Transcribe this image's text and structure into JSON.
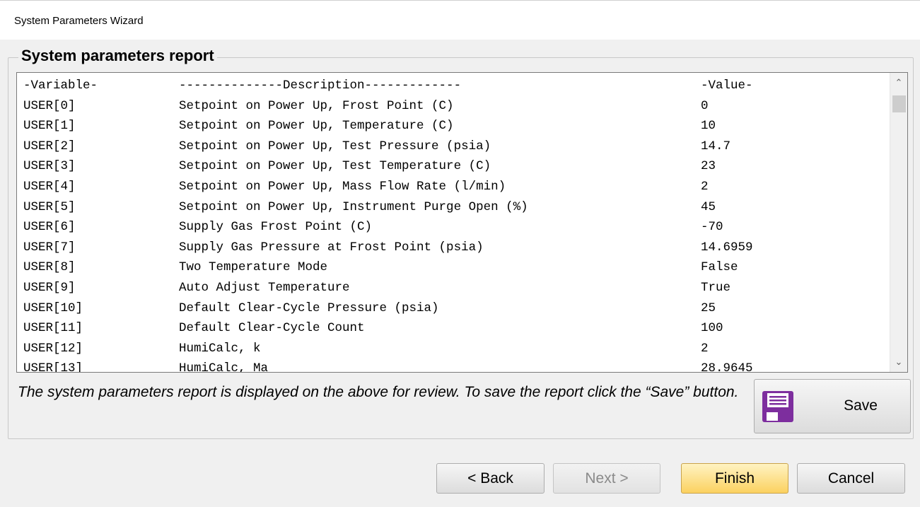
{
  "window": {
    "title": "System Parameters Wizard"
  },
  "group": {
    "legend": "System parameters report"
  },
  "report": {
    "header": {
      "variable": "-Variable-",
      "description": "--------------Description-------------",
      "value": "-Value-"
    },
    "rows": [
      {
        "variable": "USER[0]",
        "description": "Setpoint on Power Up, Frost Point (C)",
        "value": "0"
      },
      {
        "variable": "USER[1]",
        "description": "Setpoint on Power Up, Temperature (C)",
        "value": "10"
      },
      {
        "variable": "USER[2]",
        "description": "Setpoint on Power Up, Test Pressure (psia)",
        "value": "14.7"
      },
      {
        "variable": "USER[3]",
        "description": "Setpoint on Power Up, Test Temperature (C)",
        "value": "23"
      },
      {
        "variable": "USER[4]",
        "description": "Setpoint on Power Up, Mass Flow Rate (l/min)",
        "value": "2"
      },
      {
        "variable": "USER[5]",
        "description": "Setpoint on Power Up, Instrument Purge Open (%)",
        "value": "45"
      },
      {
        "variable": "USER[6]",
        "description": "Supply Gas Frost Point (C)",
        "value": "-70"
      },
      {
        "variable": "USER[7]",
        "description": "Supply Gas Pressure at Frost Point (psia)",
        "value": "14.6959"
      },
      {
        "variable": "USER[8]",
        "description": "Two Temperature Mode",
        "value": "False"
      },
      {
        "variable": "USER[9]",
        "description": "Auto Adjust Temperature",
        "value": "True"
      },
      {
        "variable": "USER[10]",
        "description": "Default Clear-Cycle Pressure (psia)",
        "value": "25"
      },
      {
        "variable": "USER[11]",
        "description": "Default Clear-Cycle Count",
        "value": "100"
      },
      {
        "variable": "USER[12]",
        "description": "HumiCalc, k",
        "value": "2"
      },
      {
        "variable": "USER[13]",
        "description": "HumiCalc, Ma",
        "value": "28.9645"
      }
    ]
  },
  "note": "The system parameters report is displayed on the above for review.  To save the report click the “Save” button.",
  "buttons": {
    "save": "Save",
    "back": "< Back",
    "next": "Next >",
    "finish": "Finish",
    "cancel": "Cancel"
  },
  "icons": {
    "save": "floppy-disk-icon",
    "scroll_up": "chevron-up-icon",
    "scroll_down": "chevron-down-icon"
  },
  "colors": {
    "floppy": "#7d2e9e",
    "finish_accent": "#fbd160"
  }
}
